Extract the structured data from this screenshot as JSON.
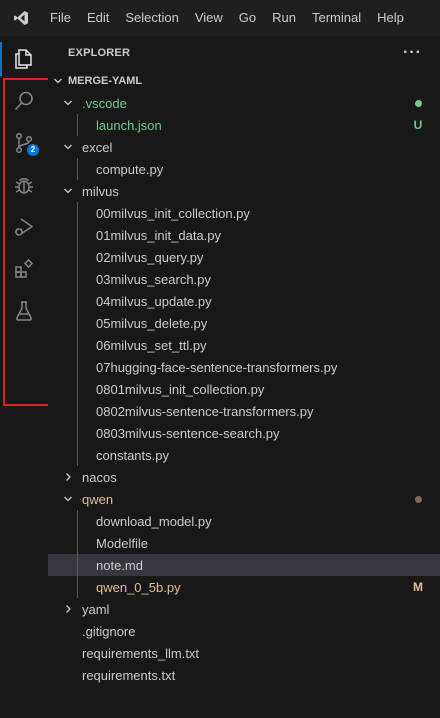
{
  "menu": [
    "File",
    "Edit",
    "Selection",
    "View",
    "Go",
    "Run",
    "Terminal",
    "Help"
  ],
  "explorer": {
    "title": "EXPLORER",
    "more": "···"
  },
  "workspace": {
    "name": "MERGE-YAML"
  },
  "activity": {
    "scm_badge": "2"
  },
  "colors": {
    "accent": "#0078d4",
    "untracked": "#73c991",
    "modified": "#e2c08d",
    "highlight_box": "#e51d1d",
    "selected_row": "#37373d"
  },
  "tree": [
    {
      "label": ".vscode",
      "depth": 0,
      "kind": "folder",
      "open": true,
      "color": "#73c991",
      "deco": "dot",
      "deco_color": "#73c991"
    },
    {
      "label": "launch.json",
      "depth": 1,
      "kind": "file",
      "color": "#73c991",
      "deco": "U",
      "deco_color": "#73c991"
    },
    {
      "label": "excel",
      "depth": 0,
      "kind": "folder",
      "open": true
    },
    {
      "label": "compute.py",
      "depth": 1,
      "kind": "file"
    },
    {
      "label": "milvus",
      "depth": 0,
      "kind": "folder",
      "open": true
    },
    {
      "label": "00milvus_init_collection.py",
      "depth": 1,
      "kind": "file"
    },
    {
      "label": "01milvus_init_data.py",
      "depth": 1,
      "kind": "file"
    },
    {
      "label": "02milvus_query.py",
      "depth": 1,
      "kind": "file"
    },
    {
      "label": "03milvus_search.py",
      "depth": 1,
      "kind": "file"
    },
    {
      "label": "04milvus_update.py",
      "depth": 1,
      "kind": "file"
    },
    {
      "label": "05milvus_delete.py",
      "depth": 1,
      "kind": "file"
    },
    {
      "label": "06milvus_set_ttl.py",
      "depth": 1,
      "kind": "file"
    },
    {
      "label": "07hugging-face-sentence-transformers.py",
      "depth": 1,
      "kind": "file"
    },
    {
      "label": "0801milvus_init_collection.py",
      "depth": 1,
      "kind": "file"
    },
    {
      "label": "0802milvus-sentence-transformers.py",
      "depth": 1,
      "kind": "file"
    },
    {
      "label": "0803milvus-sentence-search.py",
      "depth": 1,
      "kind": "file"
    },
    {
      "label": "constants.py",
      "depth": 1,
      "kind": "file"
    },
    {
      "label": "nacos",
      "depth": 0,
      "kind": "folder",
      "open": false
    },
    {
      "label": "qwen",
      "depth": 0,
      "kind": "folder",
      "open": true,
      "color": "#e2c08d",
      "deco": "dot",
      "deco_color": "#7a6a50"
    },
    {
      "label": "download_model.py",
      "depth": 1,
      "kind": "file"
    },
    {
      "label": "Modelfile",
      "depth": 1,
      "kind": "file"
    },
    {
      "label": "note.md",
      "depth": 1,
      "kind": "file",
      "selected": true
    },
    {
      "label": "qwen_0_5b.py",
      "depth": 1,
      "kind": "file",
      "color": "#e2c08d",
      "deco": "M",
      "deco_color": "#e2c08d"
    },
    {
      "label": "yaml",
      "depth": 0,
      "kind": "folder",
      "open": false
    },
    {
      "label": ".gitignore",
      "depth": 0,
      "kind": "file"
    },
    {
      "label": "requirements_llm.txt",
      "depth": 0,
      "kind": "file"
    },
    {
      "label": "requirements.txt",
      "depth": 0,
      "kind": "file"
    }
  ]
}
